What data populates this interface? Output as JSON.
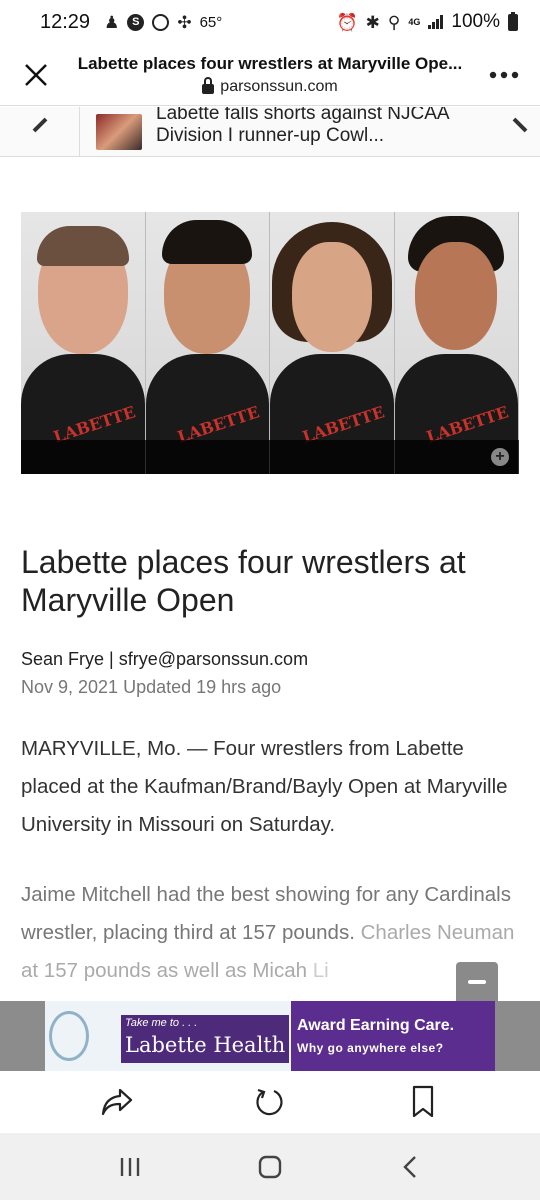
{
  "status_bar": {
    "time": "12:29",
    "temperature": "65°",
    "network": "4G",
    "battery": "100%"
  },
  "browser": {
    "title": "Labette places four wrestlers at Maryville Ope...",
    "domain": "parsonssun.com",
    "close_icon": "close-icon",
    "more_icon": "more-icon"
  },
  "related": {
    "text": "Labette falls shorts against NJCAA Division I runner-up Cowl..."
  },
  "hero": {
    "jacket_text": "LABETTE",
    "zoom_icon": "zoom-in-icon"
  },
  "article": {
    "headline": "Labette places four wrestlers at Maryville Open",
    "byline": "Sean Frye | sfrye@parsonssun.com",
    "date": "Nov 9, 2021 Updated 19 hrs ago",
    "para1": "MARYVILLE, Mo. — Four wrestlers from Labette placed at the Kaufman/Brand/Bayly Open at Maryville University in Missouri on Saturday.",
    "para2_a": "Jaime Mitchell had the best showing for any Cardinals wrestler, placing third at 157 pounds.",
    "para2_b": "Charles Neuman at 157 pounds as well as Micah",
    "para2_c": "Li"
  },
  "ad": {
    "tagline": "Take me to . . .",
    "brand": "Labette Health",
    "headline": "Award Earning Care.",
    "subline": "Why go anywhere else?"
  },
  "toolbar": {
    "share_icon": "share-icon",
    "refresh_icon": "refresh-icon",
    "bookmark_icon": "bookmark-icon"
  },
  "nav": {
    "recents_icon": "recents-icon",
    "home_icon": "home-icon",
    "back_icon": "back-icon"
  },
  "colors": {
    "ad_purple": "#5a2d8e",
    "jacket_red": "#c7322b"
  }
}
